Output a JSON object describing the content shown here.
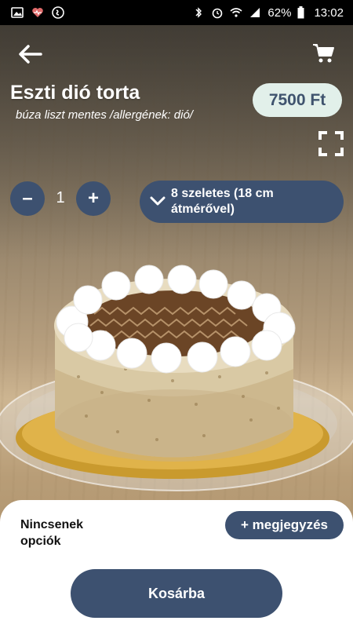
{
  "status_bar": {
    "battery": "62%",
    "time": "13:02",
    "left_icons": [
      "image-icon",
      "heart-monitor-icon",
      "shazam-icon"
    ],
    "right_icons": [
      "bluetooth-icon",
      "alarm-icon",
      "wifi-icon",
      "signal-icon",
      "battery-icon"
    ]
  },
  "product": {
    "title": "Eszti dió torta",
    "subtitle": "búza liszt mentes /allergének: dió/",
    "price": "7500 Ft"
  },
  "quantity": {
    "minus": "–",
    "value": "1",
    "plus": "+"
  },
  "variant": {
    "line1": "8 szeletes (18 cm",
    "line2": "átmérővel)"
  },
  "options": {
    "no_options_line1": "Nincsenek",
    "no_options_line2": "opciók",
    "add_note": "+ megjegyzés"
  },
  "actions": {
    "add_to_cart": "Kosárba"
  },
  "colors": {
    "accent": "#3d5170",
    "price_bg": "#e2f0ea",
    "price_text": "#3f536e"
  }
}
